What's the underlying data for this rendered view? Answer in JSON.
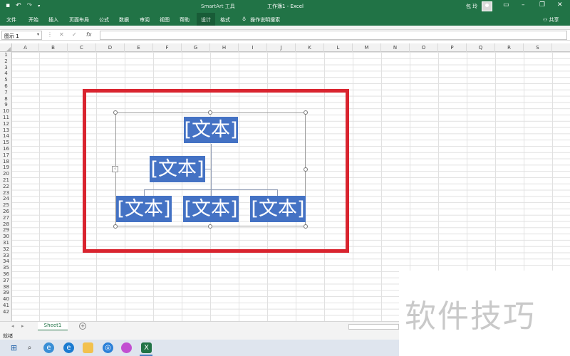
{
  "title_bar": {
    "context_tool": "SmartArt 工具",
    "document_title": "工作簿1  -  Excel",
    "user_name": "包 玲"
  },
  "ribbon": {
    "tabs": [
      {
        "label": "文件"
      },
      {
        "label": "开始"
      },
      {
        "label": "插入"
      },
      {
        "label": "页面布局"
      },
      {
        "label": "公式"
      },
      {
        "label": "数据"
      },
      {
        "label": "审阅"
      },
      {
        "label": "视图"
      },
      {
        "label": "帮助"
      },
      {
        "label": "设计"
      },
      {
        "label": "格式"
      }
    ],
    "tell_me": "操作说明搜索",
    "share": "共享"
  },
  "formula_bar": {
    "name_box": "图示 1",
    "formula": ""
  },
  "grid": {
    "columns": [
      "A",
      "B",
      "C",
      "D",
      "E",
      "F",
      "G",
      "H",
      "I",
      "J",
      "K",
      "L",
      "M",
      "N",
      "O",
      "P",
      "Q",
      "R",
      "S"
    ],
    "rows": [
      "1",
      "2",
      "3",
      "4",
      "5",
      "6",
      "7",
      "8",
      "9",
      "10",
      "11",
      "12",
      "13",
      "14",
      "15",
      "16",
      "17",
      "18",
      "19",
      "20",
      "21",
      "22",
      "23",
      "24",
      "25",
      "26",
      "27",
      "28",
      "29",
      "30",
      "31",
      "32",
      "33",
      "34",
      "35",
      "36",
      "37",
      "38",
      "39",
      "40",
      "41",
      "42"
    ]
  },
  "smartart": {
    "top": "[文本]",
    "assistant": "[文本]",
    "children": [
      "[文本]",
      "[文本]",
      "[文本]"
    ],
    "node_color": "#4472c4"
  },
  "highlight_color": "#d9242f",
  "sheets": [
    {
      "name": "Sheet1"
    }
  ],
  "status_bar": {
    "mode": "就绪"
  },
  "watermark": "软件技巧",
  "colors": {
    "excel_green": "#217346"
  }
}
